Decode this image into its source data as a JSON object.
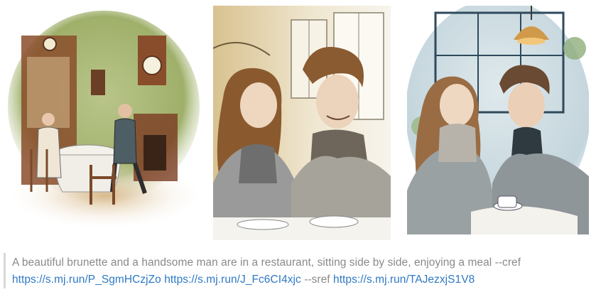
{
  "images": [
    {
      "subject": "Watercolor sketch of a couple dining in a vintage green parlor with clocks"
    },
    {
      "subject": "Ink sketch of a brunette woman and young man side by side in a cafe"
    },
    {
      "subject": "Watercolor sketch of a couple in coats at a cafe table by a window"
    }
  ],
  "caption": {
    "prompt_text": "A beautiful brunette and a handsome man are in a restaurant, sitting side by side, enjoying a meal --cref",
    "link1": "https://s.mj.run/P_SgmHCzjZo",
    "link2": "https://s.mj.run/J_Fc6CI4xjc",
    "sref_text": "--sref",
    "link3": "https://s.mj.run/TAJezxjS1V8"
  },
  "colors": {
    "caption_text": "#8a8a8a",
    "link": "#2e79c4",
    "rule": "#d8d8d8"
  }
}
